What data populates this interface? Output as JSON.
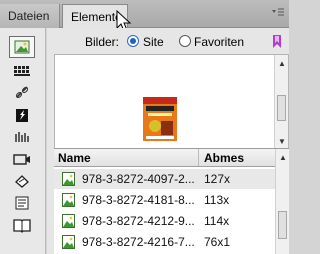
{
  "tabs": [
    {
      "label": "Dateien",
      "active": false
    },
    {
      "label": "Elemente",
      "active": true
    }
  ],
  "filter": {
    "label": "Bilder:",
    "options": [
      {
        "label": "Site",
        "selected": true
      },
      {
        "label": "Favoriten",
        "selected": false
      }
    ]
  },
  "sidebar": {
    "items": [
      {
        "icon": "images-icon",
        "active": true
      },
      {
        "icon": "colors-icon",
        "active": false
      },
      {
        "icon": "urls-icon",
        "active": false
      },
      {
        "icon": "flash-icon",
        "active": false
      },
      {
        "icon": "shockwave-icon",
        "active": false
      },
      {
        "icon": "movies-icon",
        "active": false
      },
      {
        "icon": "scripts-icon",
        "active": false
      },
      {
        "icon": "templates-icon",
        "active": false
      },
      {
        "icon": "library-icon",
        "active": false
      }
    ]
  },
  "list": {
    "columns": [
      "Name",
      "Abmes"
    ],
    "rows": [
      {
        "name": "978-3-8272-4097-2...",
        "dim": "127x",
        "selected": true
      },
      {
        "name": "978-3-8272-4181-8...",
        "dim": "113x",
        "selected": false
      },
      {
        "name": "978-3-8272-4212-9...",
        "dim": "114x",
        "selected": false
      },
      {
        "name": "978-3-8272-4216-7...",
        "dim": "76x1",
        "selected": false
      }
    ]
  },
  "colors": {
    "accent": "#1b63c8",
    "favorites_icon": "#b53bd6",
    "image_icon": "#3a9a2f",
    "book_cover": "#e8781a"
  }
}
